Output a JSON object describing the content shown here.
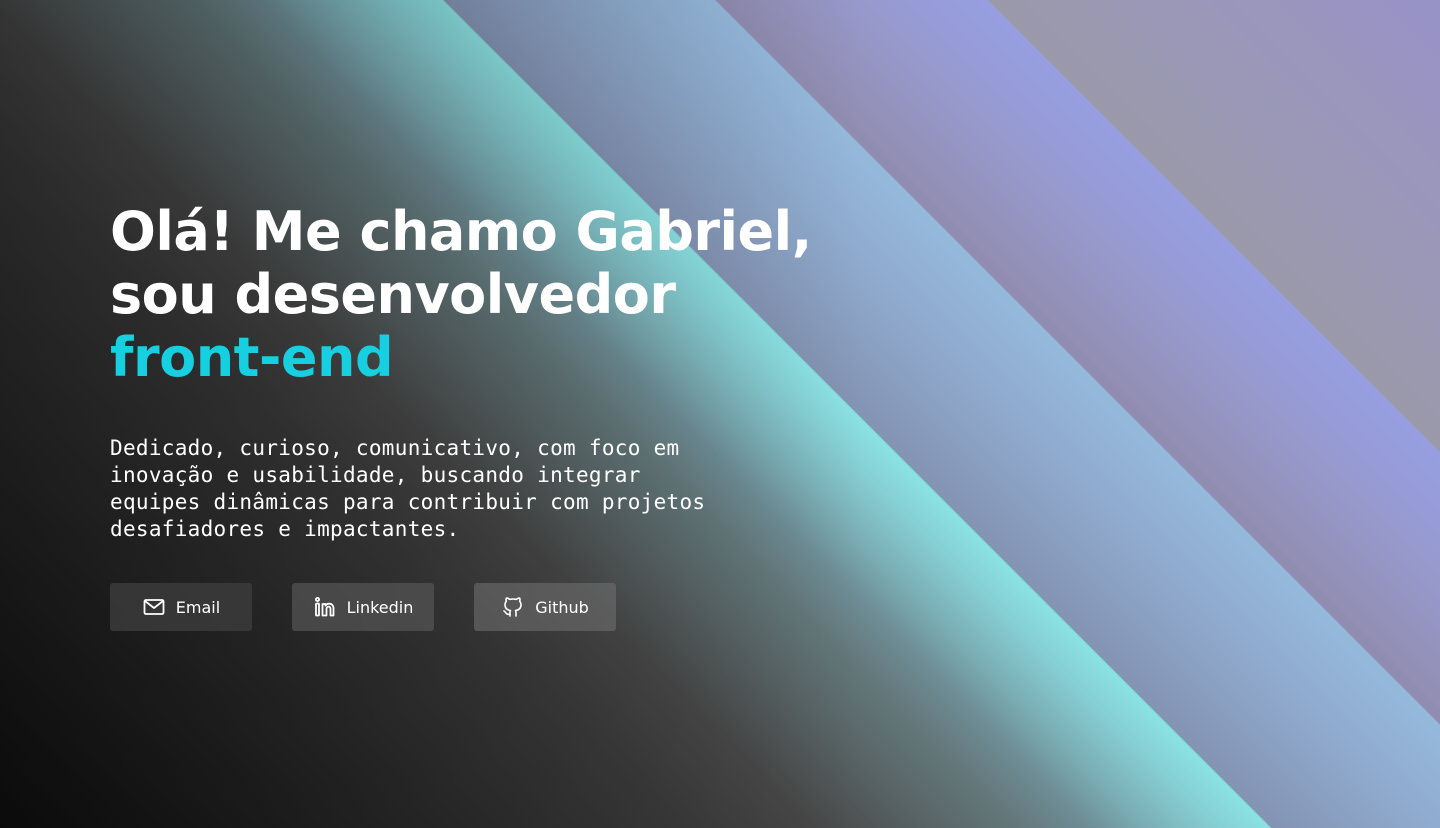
{
  "hero": {
    "headline_line1": "Olá! Me chamo Gabriel,",
    "headline_line2": "sou desenvolvedor",
    "headline_accent": "front-end",
    "accent_color": "#16cfe0",
    "description": "Dedicado, curioso, comunicativo, com foco em inovação e usabilidade, buscando integrar equipes dinâmicas para contribuir com projetos desafiadores e impactantes."
  },
  "contact_buttons": [
    {
      "label": "Email",
      "icon": "mail-icon"
    },
    {
      "label": "Linkedin",
      "icon": "linkedin-icon"
    },
    {
      "label": "Github",
      "icon": "github-icon"
    }
  ],
  "theme": {
    "background_start": "#0f0f0f",
    "stripe_cyan": "#8cf0eb",
    "stripe_blue": "#96c8eb",
    "stripe_violet": "#96a0f0",
    "text_color": "#ffffff"
  }
}
